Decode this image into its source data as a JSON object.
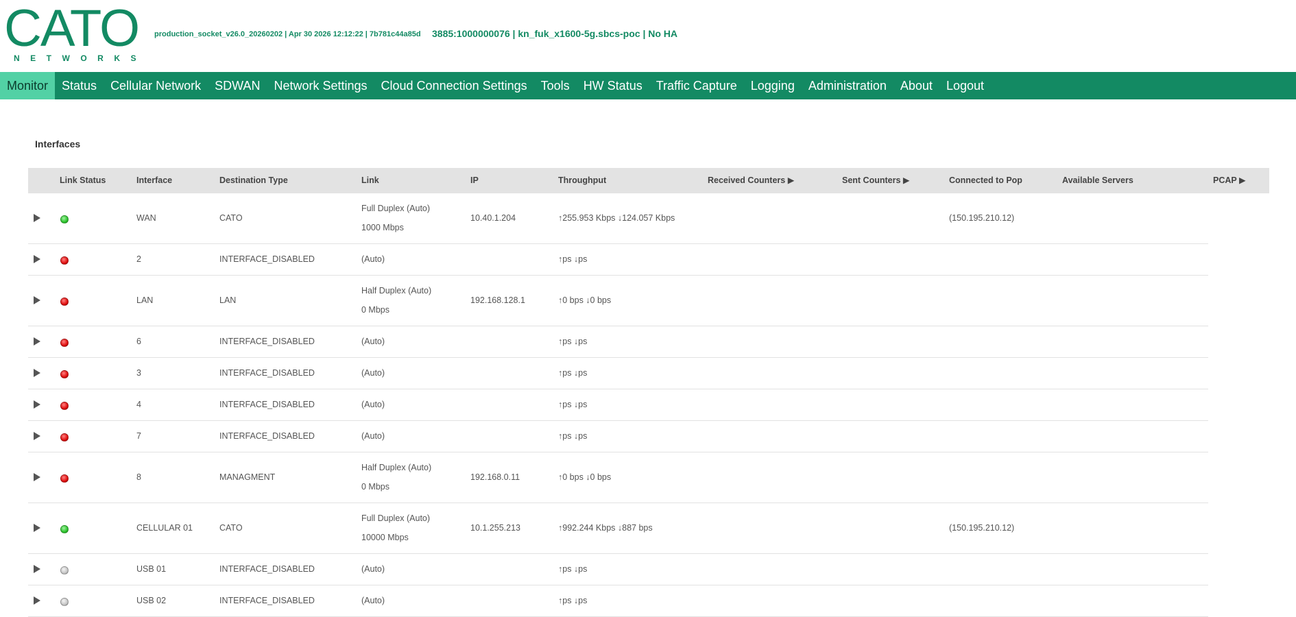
{
  "header": {
    "logo_text": "CATO",
    "logo_sub": "NETWORKS",
    "build_info": "production_socket_v26.0_20260202 | Apr 30 2026 12:12:22 | 7b781c44a85d",
    "site_info": "3885:1000000076 | kn_fuk_x1600-5g.sbcs-poc |   No HA"
  },
  "nav": [
    {
      "label": "Monitor",
      "active": true
    },
    {
      "label": "Status"
    },
    {
      "label": "Cellular Network"
    },
    {
      "label": "SDWAN"
    },
    {
      "label": "Network Settings"
    },
    {
      "label": "Cloud Connection Settings"
    },
    {
      "label": "Tools"
    },
    {
      "label": "HW Status"
    },
    {
      "label": "Traffic Capture"
    },
    {
      "label": "Logging"
    },
    {
      "label": "Administration"
    },
    {
      "label": "About"
    },
    {
      "label": "Logout"
    }
  ],
  "section_title": "Interfaces",
  "columns": {
    "link_status": "Link Status",
    "interface": "Interface",
    "destination_type": "Destination Type",
    "link": "Link",
    "ip": "IP",
    "throughput": "Throughput",
    "received_counters": "Received Counters ▶",
    "sent_counters": "Sent Counters ▶",
    "connected_to_pop": "Connected to Pop",
    "available_servers": "Available Servers",
    "pcap": "PCAP ▶"
  },
  "rows": [
    {
      "status": "green",
      "interface": "WAN",
      "dest": "CATO",
      "link1": "Full Duplex (Auto)",
      "link2": "1000 Mbps",
      "ip": "10.40.1.204",
      "throughput": "↑255.953 Kbps ↓124.057 Kbps",
      "pop": "(150.195.210.12)"
    },
    {
      "status": "red",
      "interface": "2",
      "dest": "INTERFACE_DISABLED",
      "link1": "(Auto)",
      "link2": "",
      "ip": "",
      "throughput": "↑ps ↓ps",
      "pop": ""
    },
    {
      "status": "red",
      "interface": "LAN",
      "dest": "LAN",
      "link1": "Half Duplex (Auto)",
      "link2": "0 Mbps",
      "ip": "192.168.128.1",
      "throughput": "↑0 bps ↓0 bps",
      "pop": ""
    },
    {
      "status": "red",
      "interface": "6",
      "dest": "INTERFACE_DISABLED",
      "link1": "(Auto)",
      "link2": "",
      "ip": "",
      "throughput": "↑ps ↓ps",
      "pop": ""
    },
    {
      "status": "red",
      "interface": "3",
      "dest": "INTERFACE_DISABLED",
      "link1": "(Auto)",
      "link2": "",
      "ip": "",
      "throughput": "↑ps ↓ps",
      "pop": ""
    },
    {
      "status": "red",
      "interface": "4",
      "dest": "INTERFACE_DISABLED",
      "link1": "(Auto)",
      "link2": "",
      "ip": "",
      "throughput": "↑ps ↓ps",
      "pop": ""
    },
    {
      "status": "red",
      "interface": "7",
      "dest": "INTERFACE_DISABLED",
      "link1": "(Auto)",
      "link2": "",
      "ip": "",
      "throughput": "↑ps ↓ps",
      "pop": ""
    },
    {
      "status": "red",
      "interface": "8",
      "dest": "MANAGMENT",
      "link1": "Half Duplex (Auto)",
      "link2": "0 Mbps",
      "ip": "192.168.0.11",
      "throughput": "↑0 bps ↓0 bps",
      "pop": ""
    },
    {
      "status": "green",
      "interface": "CELLULAR 01",
      "dest": "CATO",
      "link1": "Full Duplex (Auto)",
      "link2": "10000 Mbps",
      "ip": "10.1.255.213",
      "throughput": "↑992.244 Kbps ↓887 bps",
      "pop": "(150.195.210.12)"
    },
    {
      "status": "grey",
      "interface": "USB 01",
      "dest": "INTERFACE_DISABLED",
      "link1": "(Auto)",
      "link2": "",
      "ip": "",
      "throughput": "↑ps ↓ps",
      "pop": ""
    },
    {
      "status": "grey",
      "interface": "USB 02",
      "dest": "INTERFACE_DISABLED",
      "link1": "(Auto)",
      "link2": "",
      "ip": "",
      "throughput": "↑ps ↓ps",
      "pop": ""
    }
  ]
}
